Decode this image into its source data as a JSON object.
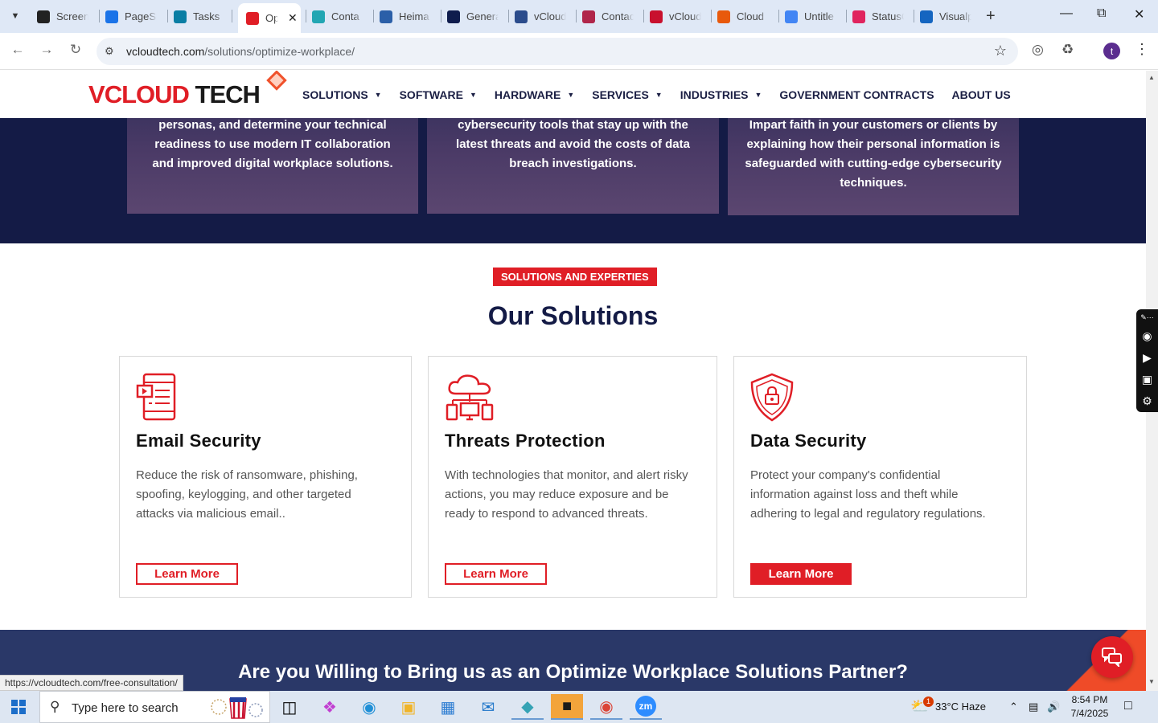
{
  "browser": {
    "tabs": [
      {
        "label": "Screen",
        "icon": "screencast-icon",
        "color": "#222222"
      },
      {
        "label": "PageSp",
        "icon": "pagespeed-icon",
        "color": "#1a73e8"
      },
      {
        "label": "Tasks",
        "icon": "tasks-icon",
        "color": "#0a7ea4"
      },
      {
        "label": "Op",
        "icon": "vcloud-logo-icon",
        "color": "#e01e26",
        "active": true
      },
      {
        "label": "Conta",
        "icon": "contact-icon",
        "color": "#22a6b3"
      },
      {
        "label": "Heima",
        "icon": "heimdal-icon",
        "color": "#2b5fa8"
      },
      {
        "label": "Genera",
        "icon": "x-logo-icon",
        "color": "#0f1c4d"
      },
      {
        "label": "vCloud",
        "icon": "check-icon",
        "color": "#2b4c8c"
      },
      {
        "label": "Contac",
        "icon": "contact-form-icon",
        "color": "#b0264a"
      },
      {
        "label": "vCloud",
        "icon": "v-icon",
        "color": "#c8102e"
      },
      {
        "label": "Cloud",
        "icon": "cloud-slash-icon",
        "color": "#e8590c"
      },
      {
        "label": "Untitle",
        "icon": "docs-icon",
        "color": "#4285f4"
      },
      {
        "label": "StatusC",
        "icon": "statuscake-icon",
        "color": "#e0245e"
      },
      {
        "label": "Visualp",
        "icon": "visualping-icon",
        "color": "#1565c0"
      }
    ],
    "url_host": "vcloudtech.com",
    "url_path": "/solutions/optimize-workplace/",
    "status_url": "https://vcloudtech.com/free-consultation/",
    "profile_initial": "t"
  },
  "site": {
    "logo": {
      "v": "V",
      "cloud": "CLOUD",
      "tech": " TECH"
    },
    "menu": [
      {
        "label": "SOLUTIONS",
        "dropdown": true
      },
      {
        "label": "SOFTWARE",
        "dropdown": true
      },
      {
        "label": "HARDWARE",
        "dropdown": true
      },
      {
        "label": "SERVICES",
        "dropdown": true
      },
      {
        "label": "INDUSTRIES",
        "dropdown": true
      },
      {
        "label": "GOVERNMENT CONTRACTS",
        "dropdown": false
      },
      {
        "label": "ABOUT US",
        "dropdown": false
      }
    ],
    "features": [
      "personas, and determine your technical readiness to use modern IT collaboration and improved digital workplace solutions.",
      "cybersecurity tools that stay up with the latest threats and avoid the costs of data breach investigations.",
      "Impart faith in your customers or clients by explaining how their personal information is safeguarded with cutting-edge cybersecurity techniques."
    ],
    "solutions_tag": "SOLUTIONS AND EXPERTIES",
    "solutions_title": "Our Solutions",
    "solutions": [
      {
        "title": "Email Security",
        "icon": "email-tablet-icon",
        "desc": "Reduce the risk of ransomware, phishing, spoofing, keylogging, and other targeted attacks via malicious email..",
        "button": "Learn More",
        "filled": false
      },
      {
        "title": "Threats Protection",
        "icon": "cloud-network-icon",
        "desc": "With technologies that monitor, and alert risky actions, you may reduce exposure and be ready to respond to advanced threats.",
        "button": "Learn More",
        "filled": false
      },
      {
        "title": "Data Security",
        "icon": "shield-lock-icon",
        "desc": "Protect your company's confidential information against loss and theft while adhering to legal and regulatory regulations.",
        "button": "Learn More",
        "filled": true
      }
    ],
    "cta_title": "Are you Willing to Bring us as an Optimize Workplace Solutions Partner?",
    "brand_red": "#e01e26",
    "brand_navy": "#141b46"
  },
  "taskbar": {
    "search_placeholder": "Type here to search",
    "weather": "33°C  Haze",
    "time": "8:54 PM",
    "date": "7/4/2025",
    "notification_badge": "1"
  }
}
